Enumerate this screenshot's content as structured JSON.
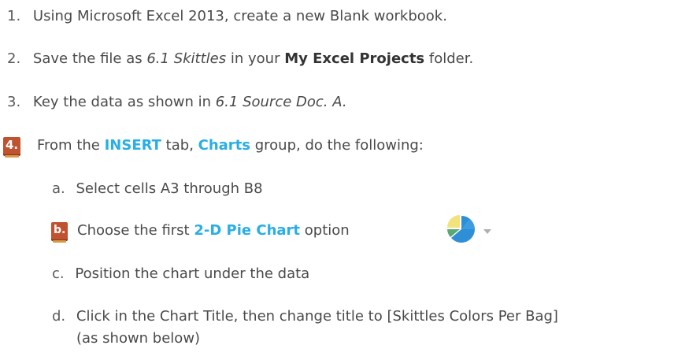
{
  "steps": {
    "s1": {
      "number": "1.",
      "text": "Using Microsoft Excel 2013, create a new Blank workbook."
    },
    "s2": {
      "number": "2.",
      "pre": "Save the file as ",
      "filename": "6.1 Skittles",
      "mid": " in your ",
      "folder": "My Excel Projects",
      "post": " folder."
    },
    "s3": {
      "number": "3.",
      "pre": "Key the data as shown in ",
      "source": "6.1 Source Doc. A.",
      "post": ""
    },
    "s4": {
      "number": "4.",
      "pre": "From the ",
      "tab": "INSERT",
      "mid1": " tab, ",
      "group": "Charts",
      "post": " group, do the following:"
    }
  },
  "substeps": {
    "a": {
      "letter": "a.",
      "text": "Select cells A3 through B8"
    },
    "b": {
      "letter": "b.",
      "pre": "Choose the first ",
      "highlight": "2-D Pie Chart",
      "post": " option",
      "icon": "pie-chart-icon",
      "dropdown_icon": "dropdown-arrow-icon"
    },
    "c": {
      "letter": "c.",
      "text": "Position the chart under the data"
    },
    "d": {
      "letter": "d.",
      "line1": "Click in the Chart Title, then change title to [Skittles Colors Per Bag]",
      "line2": "(as shown below)"
    }
  },
  "colors": {
    "highlight_blue": "#29aee6",
    "badge_orange": "#c0532f",
    "body_text": "#4a4a4a"
  }
}
